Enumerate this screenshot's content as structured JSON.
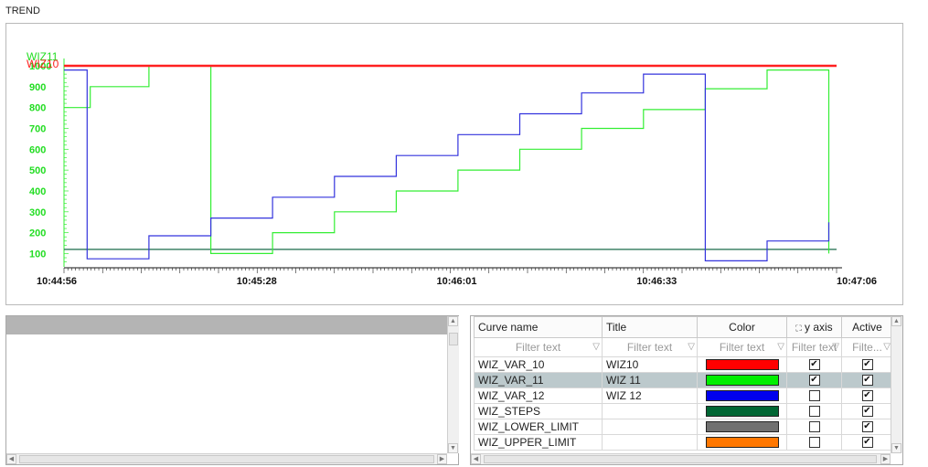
{
  "panel_title": "TREND",
  "chart_data": {
    "type": "line",
    "xlabel": "",
    "ylabel": "",
    "x_ticks": [
      "10:44:56",
      "10:45:28",
      "10:46:01",
      "10:46:33",
      "10:47:06"
    ],
    "y_ticks": [
      "100",
      "200",
      "300",
      "400",
      "500",
      "600",
      "700",
      "800",
      "900",
      "1000"
    ],
    "ylim": [
      45,
      1000
    ],
    "inline_labels": [
      "WIZ11",
      "WIZ10"
    ],
    "series": [
      {
        "name": "WIZ10",
        "color": "#ff2020",
        "points": [
          [
            0,
            1000
          ],
          [
            100,
            1000
          ]
        ]
      },
      {
        "name": "WIZ 11",
        "color": "#33ee33",
        "points": [
          [
            0,
            800
          ],
          [
            3.4,
            800
          ],
          [
            3.4,
            900
          ],
          [
            11,
            900
          ],
          [
            11,
            1000
          ],
          [
            19,
            1000
          ],
          [
            19,
            100
          ],
          [
            27,
            100
          ],
          [
            27,
            200
          ],
          [
            35,
            200
          ],
          [
            35,
            300
          ],
          [
            43,
            300
          ],
          [
            43,
            400
          ],
          [
            51,
            400
          ],
          [
            51,
            500
          ],
          [
            59,
            500
          ],
          [
            59,
            600
          ],
          [
            67,
            600
          ],
          [
            67,
            700
          ],
          [
            75,
            700
          ],
          [
            75,
            790
          ],
          [
            83,
            790
          ],
          [
            83,
            890
          ],
          [
            91,
            890
          ],
          [
            91,
            980
          ],
          [
            99,
            980
          ],
          [
            99,
            100
          ]
        ]
      },
      {
        "name": "WIZ 12",
        "color": "#3333dd",
        "points": [
          [
            0,
            980
          ],
          [
            3,
            980
          ],
          [
            3,
            75
          ],
          [
            11,
            75
          ],
          [
            11,
            185
          ],
          [
            19,
            185
          ],
          [
            19,
            270
          ],
          [
            27,
            270
          ],
          [
            27,
            370
          ],
          [
            35,
            370
          ],
          [
            35,
            470
          ],
          [
            43,
            470
          ],
          [
            43,
            570
          ],
          [
            51,
            570
          ],
          [
            51,
            670
          ],
          [
            59,
            670
          ],
          [
            59,
            770
          ],
          [
            67,
            770
          ],
          [
            67,
            870
          ],
          [
            75,
            870
          ],
          [
            75,
            960
          ],
          [
            83,
            960
          ],
          [
            83,
            65
          ],
          [
            91,
            65
          ],
          [
            91,
            160
          ],
          [
            99,
            160
          ],
          [
            99,
            250
          ]
        ]
      },
      {
        "name": "WIZ_STEPS",
        "color": "#1a6b4a",
        "points": [
          [
            0,
            120
          ],
          [
            100,
            120
          ]
        ]
      }
    ]
  },
  "left_panel": {
    "label": ""
  },
  "table": {
    "headers": {
      "curve_name": "Curve name",
      "title": "Title",
      "color": "Color",
      "y_axis": "y axis",
      "active": "Active"
    },
    "filter_placeholders": {
      "curve_name": "Filter text",
      "title": "Filter text",
      "color": "Filter text",
      "y_axis": "Filter text",
      "active": "Filte..."
    },
    "rows": [
      {
        "curve_name": "WIZ_VAR_10",
        "title": "WIZ10",
        "color": "#ff0000",
        "y_axis": true,
        "active": true,
        "selected": false
      },
      {
        "curve_name": "WIZ_VAR_11",
        "title": "WIZ 11",
        "color": "#00ee00",
        "y_axis": true,
        "active": true,
        "selected": true
      },
      {
        "curve_name": "WIZ_VAR_12",
        "title": "WIZ 12",
        "color": "#0000ee",
        "y_axis": false,
        "active": true,
        "selected": false
      },
      {
        "curve_name": "WIZ_STEPS",
        "title": "",
        "color": "#006633",
        "y_axis": false,
        "active": true,
        "selected": false
      },
      {
        "curve_name": "WIZ_LOWER_LIMIT",
        "title": "",
        "color": "#707070",
        "y_axis": false,
        "active": true,
        "selected": false
      },
      {
        "curve_name": "WIZ_UPPER_LIMIT",
        "title": "",
        "color": "#ff7700",
        "y_axis": false,
        "active": true,
        "selected": false
      }
    ]
  }
}
